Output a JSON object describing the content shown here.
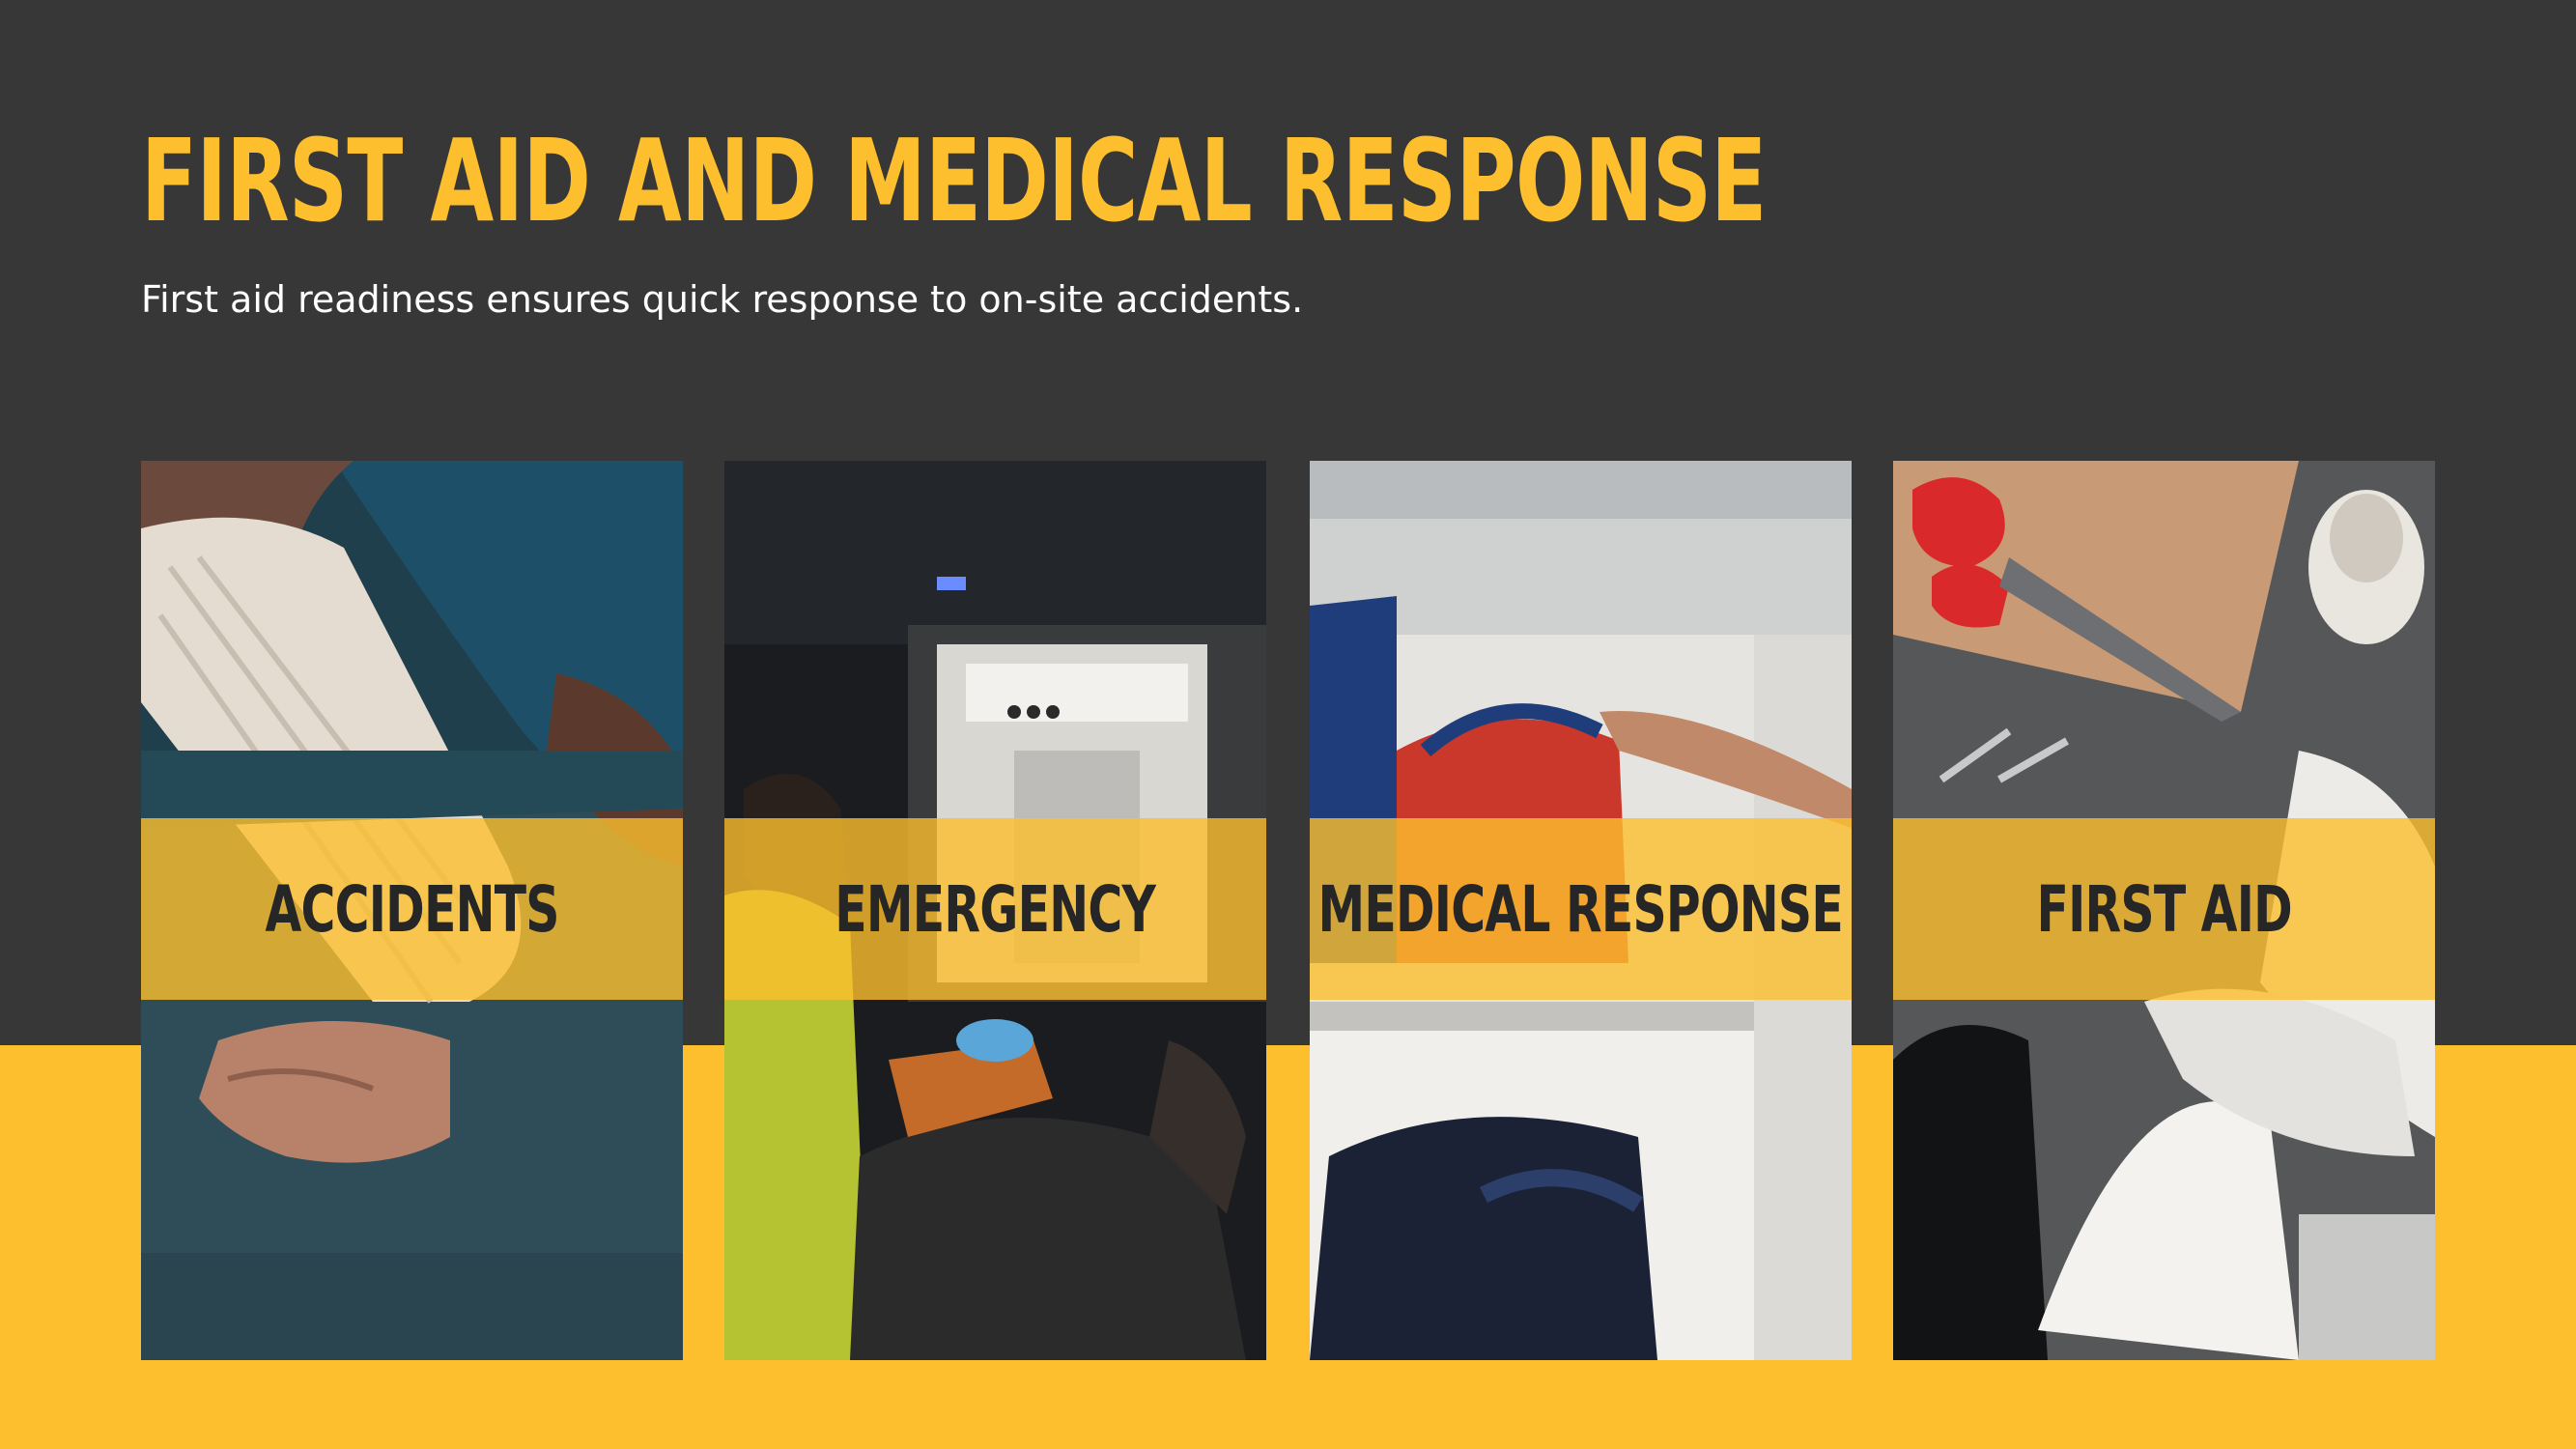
{
  "slide": {
    "title": "FIRST AID AND MEDICAL RESPONSE",
    "subtitle": "First aid readiness ensures quick response to on-site accidents."
  },
  "cards": [
    {
      "label": "ACCIDENTS",
      "photo": "bandaged-wrist-photo"
    },
    {
      "label": "EMERGENCY",
      "photo": "ambulance-interior-photo"
    },
    {
      "label": "MEDICAL RESPONSE",
      "photo": "medical-bag-shelf-photo"
    },
    {
      "label": "FIRST AID",
      "photo": "first-aid-supplies-photo"
    }
  ],
  "colors": {
    "background": "#373737",
    "accent": "#FDBF2D",
    "label_text": "#262626",
    "subtitle_text": "#FFFFFF"
  }
}
